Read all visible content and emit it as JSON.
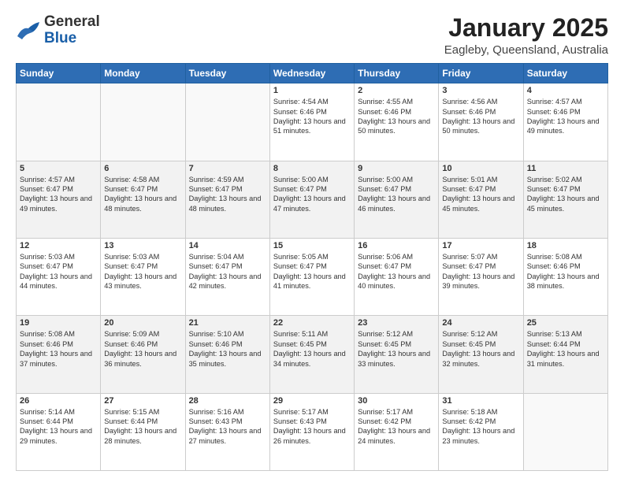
{
  "header": {
    "logo_general": "General",
    "logo_blue": "Blue",
    "month": "January 2025",
    "location": "Eagleby, Queensland, Australia"
  },
  "weekdays": [
    "Sunday",
    "Monday",
    "Tuesday",
    "Wednesday",
    "Thursday",
    "Friday",
    "Saturday"
  ],
  "weeks": [
    [
      {
        "day": "",
        "content": ""
      },
      {
        "day": "",
        "content": ""
      },
      {
        "day": "",
        "content": ""
      },
      {
        "day": "1",
        "content": "Sunrise: 4:54 AM\nSunset: 6:46 PM\nDaylight: 13 hours\nand 51 minutes."
      },
      {
        "day": "2",
        "content": "Sunrise: 4:55 AM\nSunset: 6:46 PM\nDaylight: 13 hours\nand 50 minutes."
      },
      {
        "day": "3",
        "content": "Sunrise: 4:56 AM\nSunset: 6:46 PM\nDaylight: 13 hours\nand 50 minutes."
      },
      {
        "day": "4",
        "content": "Sunrise: 4:57 AM\nSunset: 6:46 PM\nDaylight: 13 hours\nand 49 minutes."
      }
    ],
    [
      {
        "day": "5",
        "content": "Sunrise: 4:57 AM\nSunset: 6:47 PM\nDaylight: 13 hours\nand 49 minutes."
      },
      {
        "day": "6",
        "content": "Sunrise: 4:58 AM\nSunset: 6:47 PM\nDaylight: 13 hours\nand 48 minutes."
      },
      {
        "day": "7",
        "content": "Sunrise: 4:59 AM\nSunset: 6:47 PM\nDaylight: 13 hours\nand 48 minutes."
      },
      {
        "day": "8",
        "content": "Sunrise: 5:00 AM\nSunset: 6:47 PM\nDaylight: 13 hours\nand 47 minutes."
      },
      {
        "day": "9",
        "content": "Sunrise: 5:00 AM\nSunset: 6:47 PM\nDaylight: 13 hours\nand 46 minutes."
      },
      {
        "day": "10",
        "content": "Sunrise: 5:01 AM\nSunset: 6:47 PM\nDaylight: 13 hours\nand 45 minutes."
      },
      {
        "day": "11",
        "content": "Sunrise: 5:02 AM\nSunset: 6:47 PM\nDaylight: 13 hours\nand 45 minutes."
      }
    ],
    [
      {
        "day": "12",
        "content": "Sunrise: 5:03 AM\nSunset: 6:47 PM\nDaylight: 13 hours\nand 44 minutes."
      },
      {
        "day": "13",
        "content": "Sunrise: 5:03 AM\nSunset: 6:47 PM\nDaylight: 13 hours\nand 43 minutes."
      },
      {
        "day": "14",
        "content": "Sunrise: 5:04 AM\nSunset: 6:47 PM\nDaylight: 13 hours\nand 42 minutes."
      },
      {
        "day": "15",
        "content": "Sunrise: 5:05 AM\nSunset: 6:47 PM\nDaylight: 13 hours\nand 41 minutes."
      },
      {
        "day": "16",
        "content": "Sunrise: 5:06 AM\nSunset: 6:47 PM\nDaylight: 13 hours\nand 40 minutes."
      },
      {
        "day": "17",
        "content": "Sunrise: 5:07 AM\nSunset: 6:47 PM\nDaylight: 13 hours\nand 39 minutes."
      },
      {
        "day": "18",
        "content": "Sunrise: 5:08 AM\nSunset: 6:46 PM\nDaylight: 13 hours\nand 38 minutes."
      }
    ],
    [
      {
        "day": "19",
        "content": "Sunrise: 5:08 AM\nSunset: 6:46 PM\nDaylight: 13 hours\nand 37 minutes."
      },
      {
        "day": "20",
        "content": "Sunrise: 5:09 AM\nSunset: 6:46 PM\nDaylight: 13 hours\nand 36 minutes."
      },
      {
        "day": "21",
        "content": "Sunrise: 5:10 AM\nSunset: 6:46 PM\nDaylight: 13 hours\nand 35 minutes."
      },
      {
        "day": "22",
        "content": "Sunrise: 5:11 AM\nSunset: 6:45 PM\nDaylight: 13 hours\nand 34 minutes."
      },
      {
        "day": "23",
        "content": "Sunrise: 5:12 AM\nSunset: 6:45 PM\nDaylight: 13 hours\nand 33 minutes."
      },
      {
        "day": "24",
        "content": "Sunrise: 5:12 AM\nSunset: 6:45 PM\nDaylight: 13 hours\nand 32 minutes."
      },
      {
        "day": "25",
        "content": "Sunrise: 5:13 AM\nSunset: 6:44 PM\nDaylight: 13 hours\nand 31 minutes."
      }
    ],
    [
      {
        "day": "26",
        "content": "Sunrise: 5:14 AM\nSunset: 6:44 PM\nDaylight: 13 hours\nand 29 minutes."
      },
      {
        "day": "27",
        "content": "Sunrise: 5:15 AM\nSunset: 6:44 PM\nDaylight: 13 hours\nand 28 minutes."
      },
      {
        "day": "28",
        "content": "Sunrise: 5:16 AM\nSunset: 6:43 PM\nDaylight: 13 hours\nand 27 minutes."
      },
      {
        "day": "29",
        "content": "Sunrise: 5:17 AM\nSunset: 6:43 PM\nDaylight: 13 hours\nand 26 minutes."
      },
      {
        "day": "30",
        "content": "Sunrise: 5:17 AM\nSunset: 6:42 PM\nDaylight: 13 hours\nand 24 minutes."
      },
      {
        "day": "31",
        "content": "Sunrise: 5:18 AM\nSunset: 6:42 PM\nDaylight: 13 hours\nand 23 minutes."
      },
      {
        "day": "",
        "content": ""
      }
    ]
  ]
}
